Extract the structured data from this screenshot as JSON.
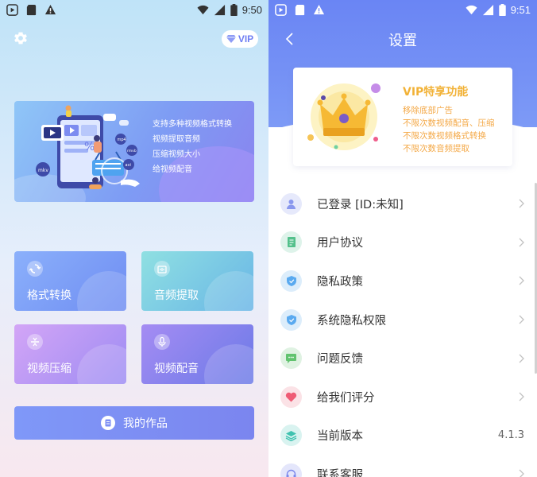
{
  "left": {
    "status": {
      "time": "9:50"
    },
    "vip_badge": "VIP",
    "banner": {
      "lines": [
        "支持多种视频格式转换",
        "视频提取音频",
        "压缩视频大小",
        "给视频配音"
      ],
      "tags": [
        "mkv",
        "mp4",
        "rmvb",
        "avi"
      ]
    },
    "tiles": [
      {
        "label": "格式转换",
        "icon": "convert-icon"
      },
      {
        "label": "音频提取",
        "icon": "audio-icon"
      },
      {
        "label": "视频压缩",
        "icon": "compress-icon"
      },
      {
        "label": "视频配音",
        "icon": "microphone-icon"
      }
    ],
    "works_button": {
      "label": "我的作品",
      "icon": "document-icon"
    }
  },
  "right": {
    "status": {
      "time": "9:51"
    },
    "title": "设置",
    "vip_card": {
      "title": "VIP特享功能",
      "lines": [
        "移除底部广告",
        "不限次数视频配音、压缩",
        "不限次数视频格式转换",
        "不限次数音频提取"
      ]
    },
    "rows": [
      {
        "label": "已登录 [ID:未知]",
        "icon": "user-icon",
        "value": ""
      },
      {
        "label": "用户协议",
        "icon": "agreement-icon",
        "value": ""
      },
      {
        "label": "隐私政策",
        "icon": "shield-icon",
        "value": ""
      },
      {
        "label": "系统隐私权限",
        "icon": "shield-check-icon",
        "value": ""
      },
      {
        "label": "问题反馈",
        "icon": "chat-icon",
        "value": ""
      },
      {
        "label": "给我们评分",
        "icon": "heart-icon",
        "value": ""
      },
      {
        "label": "当前版本",
        "icon": "layers-icon",
        "value": "4.1.3"
      },
      {
        "label": "联系客服",
        "icon": "headset-icon",
        "value": ""
      }
    ]
  },
  "colors": {
    "accent_blue": "#6a85f4",
    "vip_gold": "#f2b237",
    "vip_orange": "#f4a846"
  }
}
